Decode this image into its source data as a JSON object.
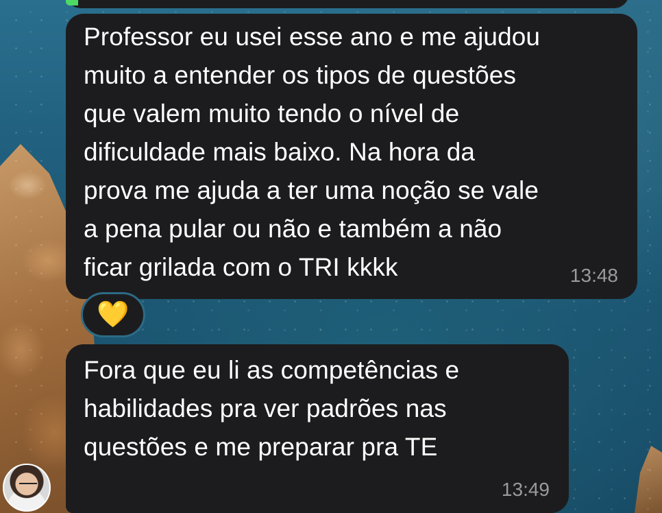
{
  "messages": [
    {
      "text": "Professor eu usei esse ano e me ajudou\nmuito a entender os tipos de questões\nque  valem muito tendo o nível de\ndificuldade mais baixo. Na hora da\nprova me ajuda a ter uma noção se vale\na pena pular ou não e também a não\nficar grilada com o TRI kkkk",
      "time": "13:48",
      "reaction": "💛"
    },
    {
      "text": "Fora que eu li as competências e\nhabilidades pra ver padrões nas\nquestões e me preparar pra TE",
      "time": "13:49"
    }
  ],
  "colors": {
    "bubble": "#1c1c1e",
    "timestamp": "#9a9a9f",
    "text": "#ffffff"
  },
  "icons": {
    "reaction": "yellow-heart-icon",
    "avatar": "user-avatar"
  }
}
